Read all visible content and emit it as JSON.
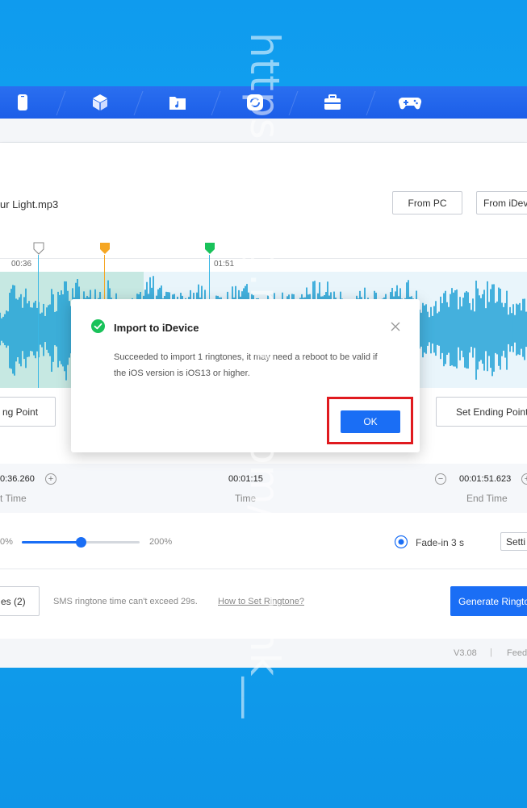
{
  "topbar": {
    "tabs": [
      {
        "icon": "phone-icon"
      },
      {
        "icon": "cube-icon"
      },
      {
        "icon": "music-folder-icon"
      },
      {
        "icon": "sync-icon"
      },
      {
        "icon": "toolbox-icon"
      },
      {
        "icon": "gamepad-icon"
      }
    ]
  },
  "editor": {
    "filename": "ur Light.mp3",
    "from_pc": "From PC",
    "from_idevice": "From iDev",
    "timestamp_start": "00:36",
    "timestamp_end": "01:51",
    "set_starting_point": "ng Point",
    "set_ending_point": "Set Ending Point",
    "start_time_value": "0:36.260",
    "start_time_label": "t Time",
    "duration_value": "00:01:15",
    "duration_label": "Time",
    "end_time_value": "00:01:51.623",
    "end_time_label": "End Time",
    "volume_min": "0%",
    "volume_max": "200%",
    "volume_level": 0.5,
    "fade_in_label": "Fade-in 3 s",
    "settings_label": "Setti",
    "ringtones_label": "es (2)",
    "sms_note": "SMS ringtone time can't exceed 29s.",
    "how_to_link": "How to Set Ringtone?",
    "generate_label": "Generate Ringto"
  },
  "status": {
    "version": "V3.08",
    "separator": "|",
    "feedback": "Feed"
  },
  "dialog": {
    "title": "Import to iDevice",
    "message": "Succeeded to import 1 ringtones, it may need a reboot to be valid if the iOS version is iOS13 or higher.",
    "ok_label": "OK"
  },
  "watermark": "https://blog.naver.com/nothink__",
  "colors": {
    "accent": "#1a6ef5",
    "waveform": "#1a9fd6",
    "start_marker": "#ffffff",
    "playhead_marker": "#f5a623",
    "end_marker": "#19c25a",
    "success": "#19c25a",
    "highlight": "#e01a1f"
  }
}
